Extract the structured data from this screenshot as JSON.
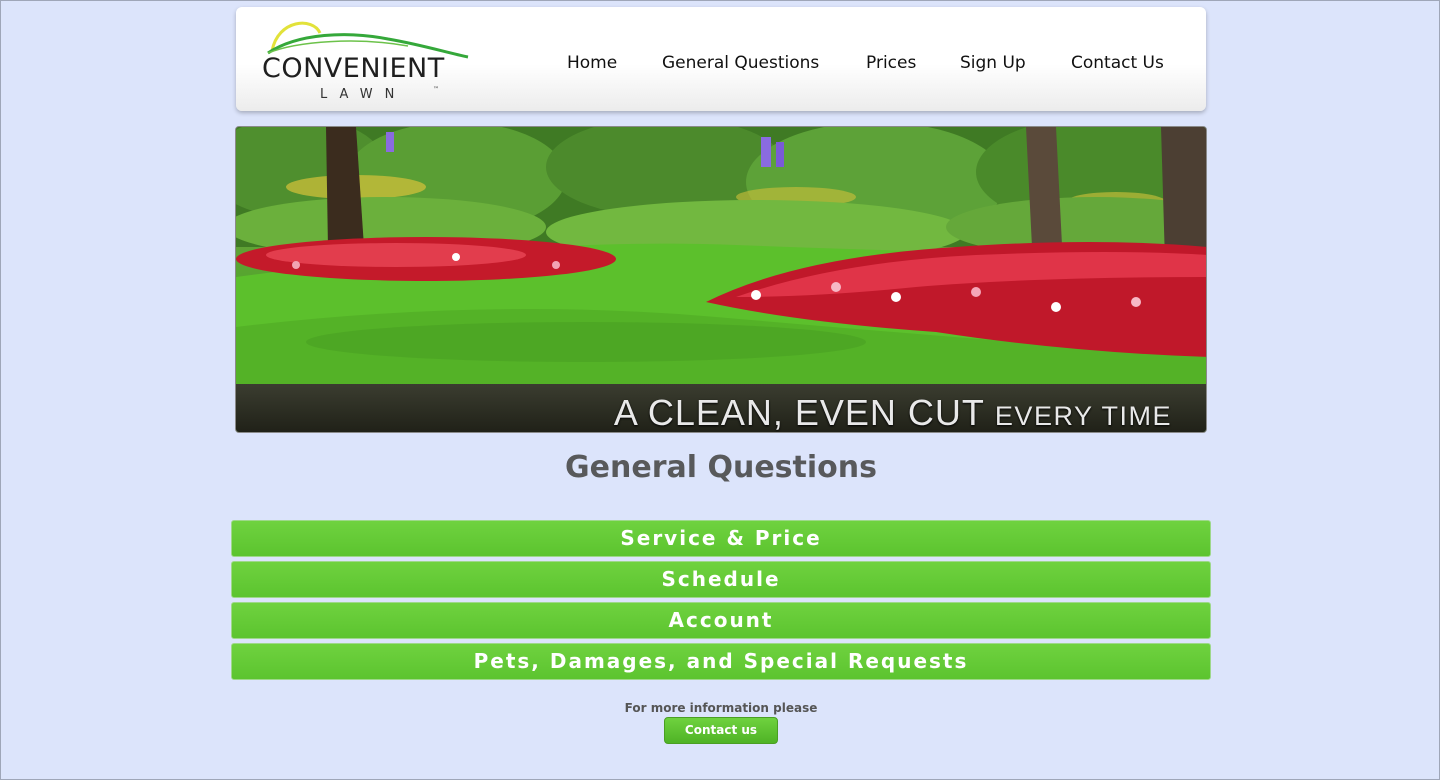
{
  "logo": {
    "name": "CONVENIENT",
    "sub": "LAWN",
    "tm": "™",
    "colors": {
      "arc_yellow": "#e2e23a",
      "arc_green": "#35a83a"
    }
  },
  "nav": {
    "items": [
      {
        "label": "Home"
      },
      {
        "label": "General Questions"
      },
      {
        "label": "Prices"
      },
      {
        "label": "Sign Up"
      },
      {
        "label": "Contact Us"
      }
    ]
  },
  "hero": {
    "tagline_main": "A CLEAN, EVEN CUT",
    "tagline_tail": "EVERY TIME",
    "description": "garden-lawn-photo"
  },
  "main": {
    "title": "General Questions",
    "accordion": [
      {
        "label": "Service & Price"
      },
      {
        "label": "Schedule"
      },
      {
        "label": "Account"
      },
      {
        "label": "Pets, Damages, and Special Requests"
      }
    ],
    "more_info": "For more information please",
    "contact_button": "Contact us"
  },
  "colors": {
    "page_bg": "#dce4fb",
    "accent_green": "#66cc33",
    "title_gray": "#58595b"
  }
}
